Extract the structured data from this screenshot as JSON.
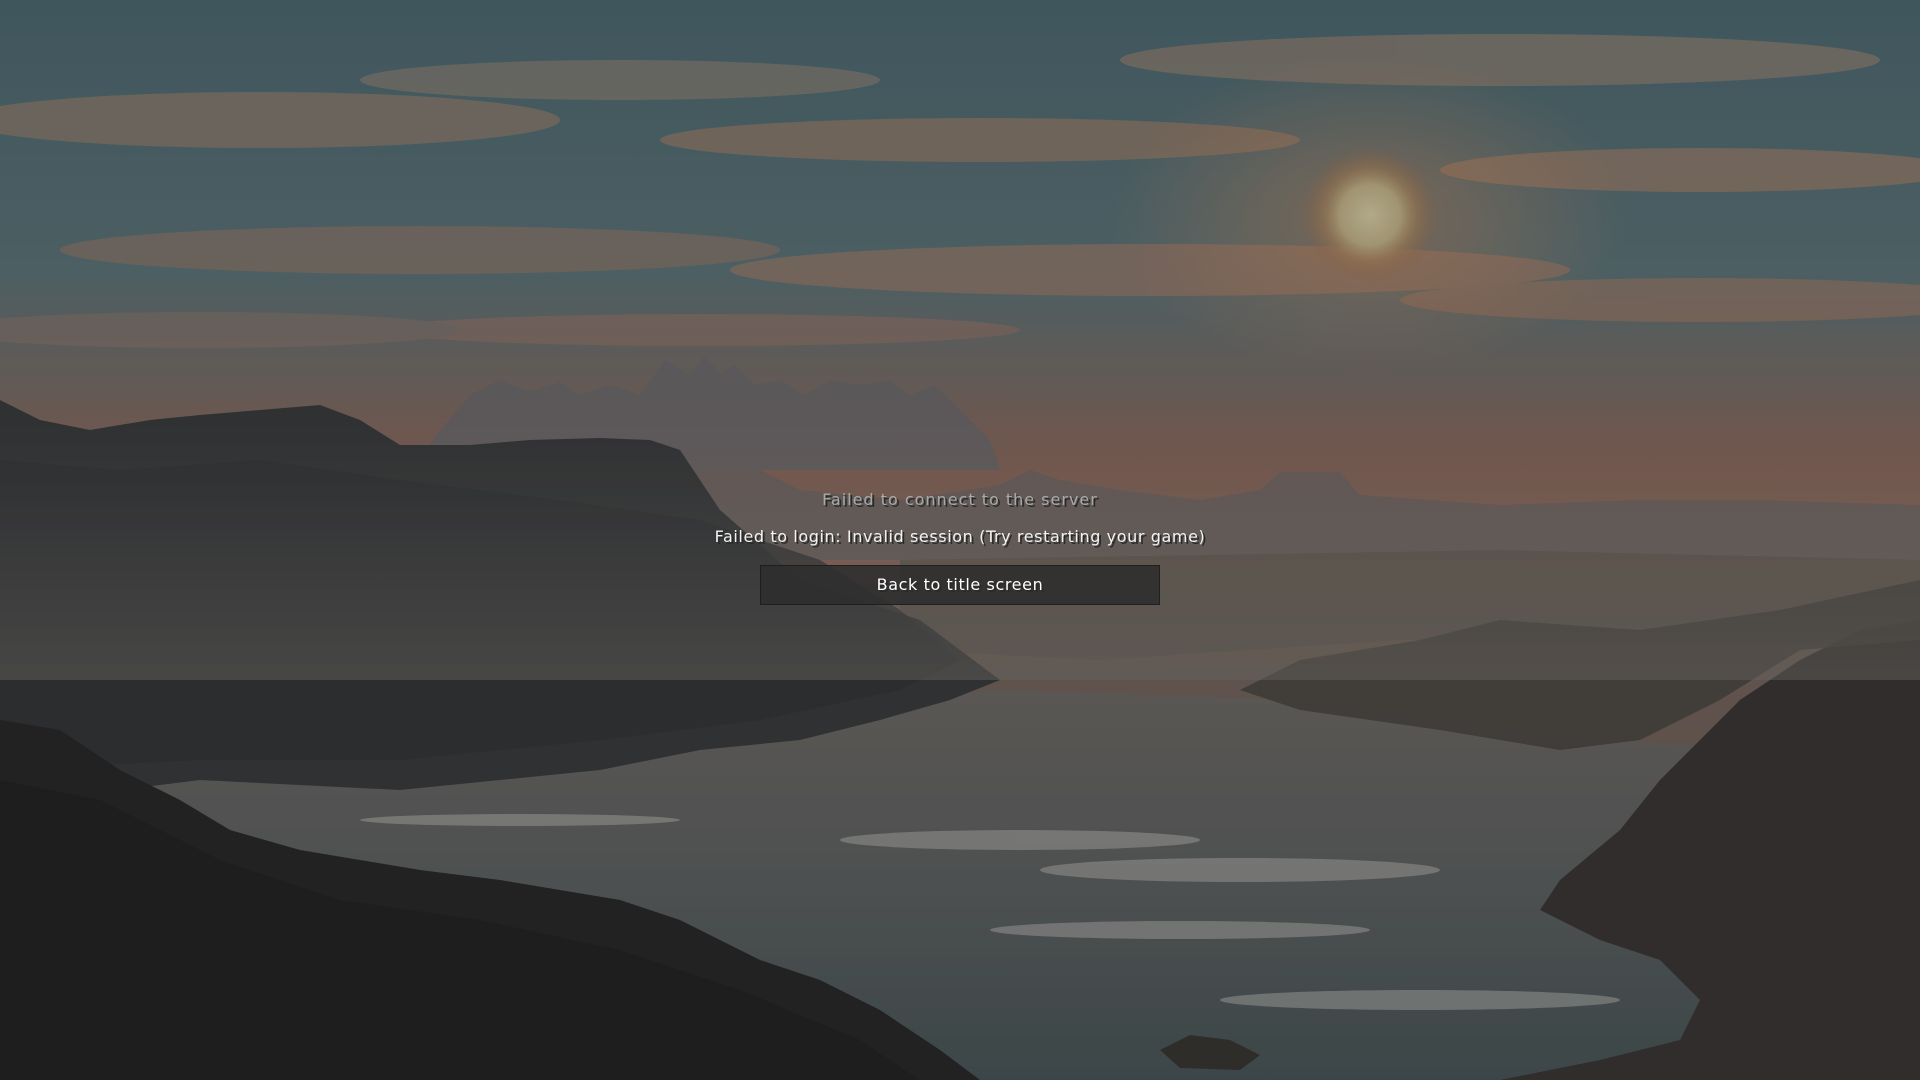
{
  "screen": {
    "title": "Failed to connect to the server",
    "detail": "Failed to login: Invalid session (Try restarting your game)",
    "back_button_label": "Back to title screen"
  },
  "colors": {
    "title_text": "#a8a8a8",
    "detail_text": "#f2f2f2",
    "button_bg": "#2d2d2d",
    "button_text": "#ffffff"
  },
  "background": {
    "scene": "panorama-sunset-coast"
  }
}
